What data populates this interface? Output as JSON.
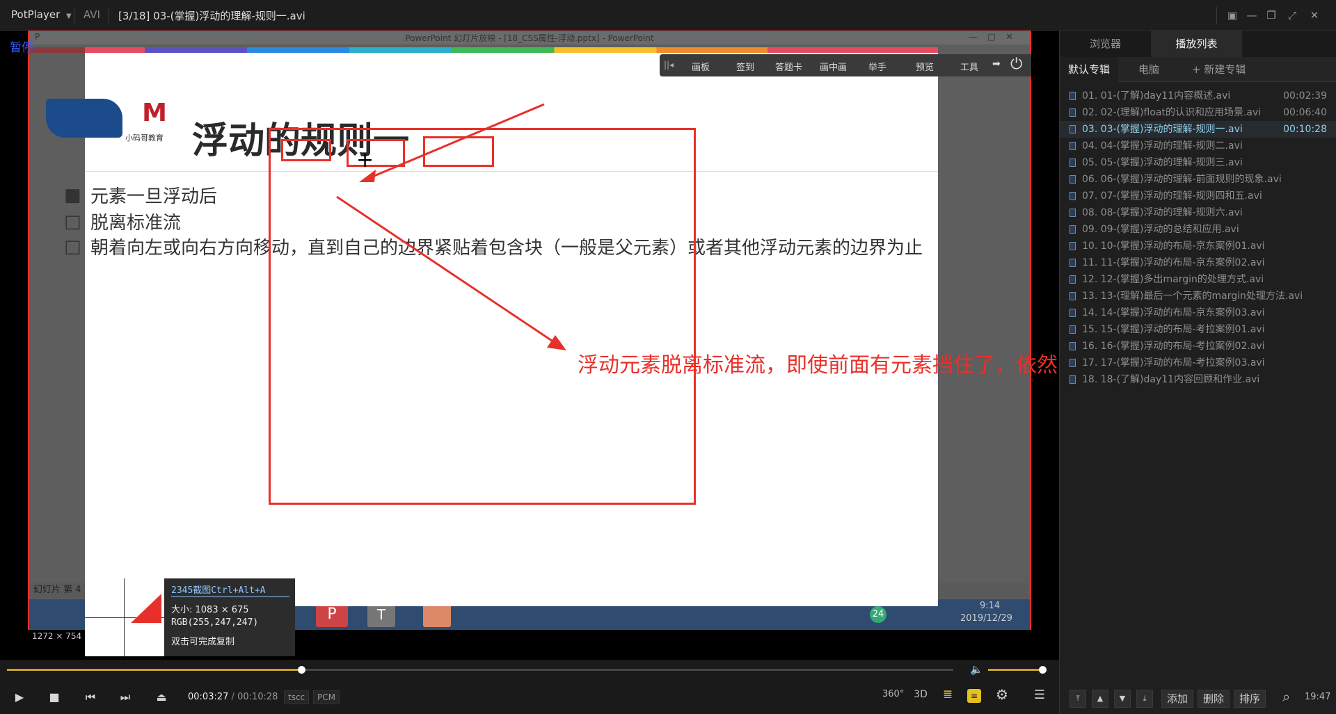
{
  "header": {
    "app_name": "PotPlayer",
    "format": "AVI",
    "title": "[3/18] 03-(掌握)浮动的理解-规则一.avi"
  },
  "video": {
    "osd_status": "暂停",
    "ppt_window_title": "PowerPoint 幻灯片放映 - [18_CSS属性-浮动.pptx] - PowerPoint",
    "slide_title": "浮动的规则一",
    "logo_text": "小码哥教育",
    "bullets": [
      "元素一旦浮动后",
      "脱离标准流",
      "朝着向左或向右方向移动，直到自己的边界紧贴着包含块（一般是父元素）或者其他浮动元素的边界为止"
    ],
    "annotation": "浮动元素脱离标准流，即使前面有元素挡住了，依然紧贴左边界",
    "toolbar": [
      "画板",
      "签到",
      "答题卡",
      "画中画",
      "举手",
      "预览",
      "工具"
    ],
    "slide_number": "幻灯片 第 4",
    "resolution": "1272 × 754",
    "screenshot_tip": {
      "title": "2345截图Ctrl+Alt+A",
      "size": "大小: 1083 × 675",
      "rgb": "RGB(255,247,247)",
      "hint": "双击可完成复制"
    },
    "taskbar_time": "9:14",
    "taskbar_date": "2019/12/29",
    "taskbar_badge": "24"
  },
  "playback": {
    "current_time": "00:03:27",
    "separator": "/",
    "total_time": "00:10:28",
    "video_codec": "tscc",
    "audio_codec": "PCM",
    "progress": 0.311,
    "volume": 0.95,
    "btn_360": "360°",
    "btn_3d": "3D"
  },
  "sidebar": {
    "tabs": [
      "浏览器",
      "播放列表"
    ],
    "active_tab": 1,
    "sub_tabs": [
      "默认专辑",
      "电脑",
      "+ 新建专辑"
    ],
    "active_sub_tab": 0,
    "footer_buttons": [
      "添加",
      "删除",
      "排序"
    ],
    "clock": "19:47"
  },
  "playlist": {
    "current_index": 2,
    "items": [
      {
        "name": "01. 01-(了解)day11内容概述.avi",
        "duration": "00:02:39"
      },
      {
        "name": "02. 02-(理解)float的认识和应用场景.avi",
        "duration": "00:06:40"
      },
      {
        "name": "03. 03-(掌握)浮动的理解-规则一.avi",
        "duration": "00:10:28"
      },
      {
        "name": "04. 04-(掌握)浮动的理解-规则二.avi",
        "duration": ""
      },
      {
        "name": "05. 05-(掌握)浮动的理解-规则三.avi",
        "duration": ""
      },
      {
        "name": "06. 06-(掌握)浮动的理解-前面规则的现象.avi",
        "duration": ""
      },
      {
        "name": "07. 07-(掌握)浮动的理解-规则四和五.avi",
        "duration": ""
      },
      {
        "name": "08. 08-(掌握)浮动的理解-规则六.avi",
        "duration": ""
      },
      {
        "name": "09. 09-(掌握)浮动的总结和应用.avi",
        "duration": ""
      },
      {
        "name": "10. 10-(掌握)浮动的布局-京东案例01.avi",
        "duration": ""
      },
      {
        "name": "11. 11-(掌握)浮动的布局-京东案例02.avi",
        "duration": ""
      },
      {
        "name": "12. 12-(掌握)多出margin的处理方式.avi",
        "duration": ""
      },
      {
        "name": "13. 13-(理解)最后一个元素的margin处理方法.avi",
        "duration": ""
      },
      {
        "name": "14. 14-(掌握)浮动的布局-京东案例03.avi",
        "duration": ""
      },
      {
        "name": "15. 15-(掌握)浮动的布局-考拉案例01.avi",
        "duration": ""
      },
      {
        "name": "16. 16-(掌握)浮动的布局-考拉案例02.avi",
        "duration": ""
      },
      {
        "name": "17. 17-(掌握)浮动的布局-考拉案例03.avi",
        "duration": ""
      },
      {
        "name": "18. 18-(了解)day11内容回顾和作业.avi",
        "duration": ""
      }
    ]
  }
}
